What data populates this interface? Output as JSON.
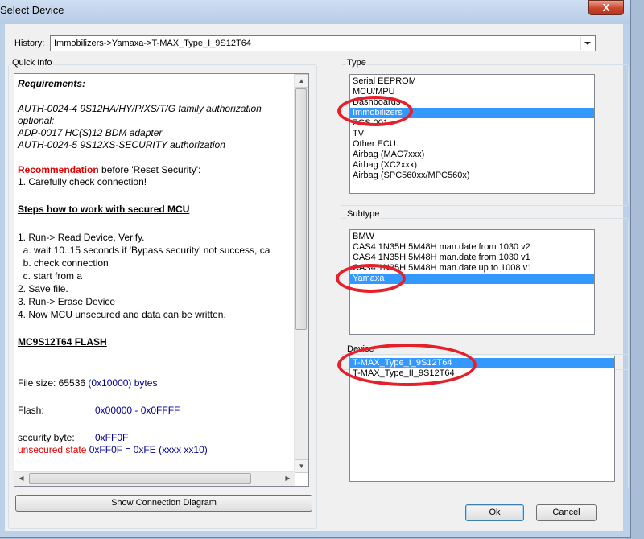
{
  "window": {
    "title": "Select Device",
    "close_glyph": "X"
  },
  "history": {
    "label": "History:",
    "value": "Immobilizers->Yamaxa->T-MAX_Type_I_9S12T64"
  },
  "quick_info": {
    "label": "Quick Info",
    "requirements_heading": "Requirements:",
    "req1": "AUTH-0024-4  9S12HA/HY/P/XS/T/G family authorization",
    "optional": "optional:",
    "req2": "ADP-0017  HC(S)12 BDM adapter",
    "req3": "AUTH-0024-5  9S12XS-SECURITY authorization",
    "recommendation_word": "Recommendation",
    "recommendation_rest": " before 'Reset Security':",
    "rec1": "1. Carefully check connection!",
    "steps_heading": "Steps how to work with secured MCU",
    "steps": [
      "1. Run-> Read Device, Verify.",
      "  a. wait 10..15 seconds if 'Bypass security' not success, ca",
      "  b. check connection",
      "  c. start from a",
      "2. Save file.",
      "3. Run-> Erase Device",
      "4. Now MCU unsecured and data can be written."
    ],
    "flash_heading": "MC9S12T64 FLASH",
    "file_size_label": "File size: 65536 ",
    "file_size_value": "(0x10000) bytes",
    "flash_label": "Flash:",
    "flash_value": "0x00000 - 0x0FFFF",
    "security_label": "security byte:",
    "security_value": "0xFF0F",
    "unsecured_label": "unsecured state ",
    "unsecured_value": "0xFF0F = 0xFE (xxxx xx10)"
  },
  "type": {
    "label": "Type",
    "items": [
      "Serial EEPROM",
      "MCU/MPU",
      "Dashboards",
      "Immobilizers",
      "ZGS 001",
      "TV",
      "Other ECU",
      "Airbag (MAC7xxx)",
      "Airbag (XC2xxx)",
      "Airbag (SPC560xx/MPC560x)"
    ],
    "selected": "Immobilizers"
  },
  "subtype": {
    "label": "Subtype",
    "items": [
      "BMW",
      "CAS4 1N35H 5M48H man.date from 1030 v2",
      "CAS4 1N35H 5M48H man.date from 1030 v1",
      "CAS4 1N35H 5M48H man.date up to 1008 v1",
      "Yamaxa"
    ],
    "selected": "Yamaxa"
  },
  "device": {
    "label": "Device",
    "items": [
      "T-MAX_Type_I_9S12T64",
      "T-MAX_Type_II_9S12T64"
    ],
    "selected": "T-MAX_Type_I_9S12T64"
  },
  "buttons": {
    "show_diagram": "Show Connection Diagram",
    "ok_underlined": "O",
    "ok_rest": "k",
    "cancel_underlined": "C",
    "cancel_rest": "ancel"
  },
  "colors": {
    "highlight_ring": "#e6202b",
    "selection": "#3399ff",
    "warning_text": "#e00000",
    "value_text": "#000090"
  }
}
